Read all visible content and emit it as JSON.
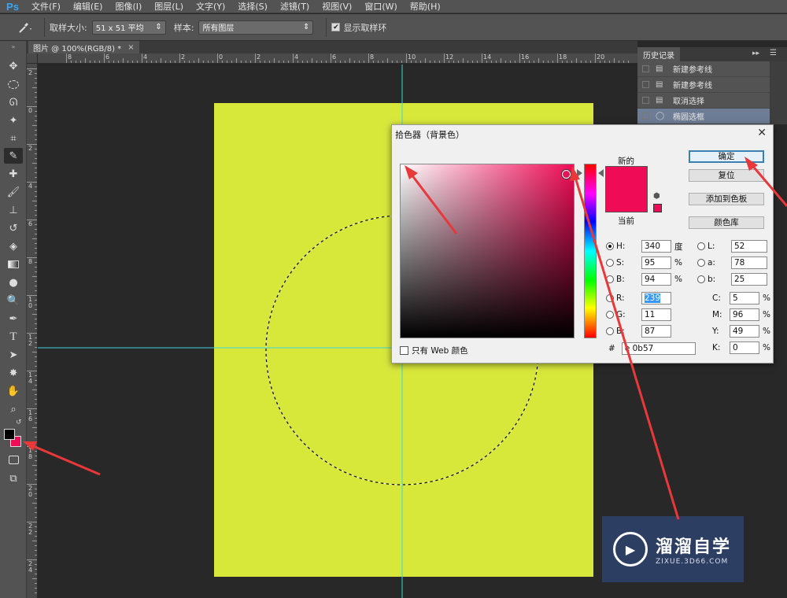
{
  "app": {
    "logo": "Ps"
  },
  "menu": [
    "文件(F)",
    "编辑(E)",
    "图像(I)",
    "图层(L)",
    "文字(Y)",
    "选择(S)",
    "滤镜(T)",
    "视图(V)",
    "窗口(W)",
    "帮助(H)"
  ],
  "options": {
    "sample_size_label": "取样大小:",
    "sample_size_value": "51 x 51 平均",
    "sample_label": "样本:",
    "sample_value": "所有图层",
    "show_ring_label": "显示取样环",
    "show_ring_checked": true
  },
  "document": {
    "tab_title": "图片 @ 100%(RGB/8) *",
    "tab_close": "×",
    "canvas_color": "#d8e83b"
  },
  "rulers": {
    "h_labels": [
      "8",
      "6",
      "4",
      "2",
      "0",
      "2",
      "4",
      "6",
      "8",
      "10",
      "12",
      "14",
      "16",
      "18",
      "20"
    ],
    "v_labels": [
      "2",
      "0",
      "2",
      "4",
      "6",
      "8",
      "1 0",
      "1 2",
      "1 4",
      "1 6",
      "1 8",
      "2 0",
      "2 2",
      "2 4"
    ]
  },
  "history": {
    "title": "历史记录",
    "items": [
      {
        "label": "新建参考线",
        "icon": "document-icon",
        "selected": false
      },
      {
        "label": "新建参考线",
        "icon": "document-icon",
        "selected": false
      },
      {
        "label": "取消选择",
        "icon": "document-icon",
        "selected": false
      },
      {
        "label": "椭圆选框",
        "icon": "ellipse-marquee-icon",
        "selected": true
      }
    ]
  },
  "picker": {
    "title": "拾色器（背景色）",
    "new_label": "新的",
    "current_label": "当前",
    "new_color": "#f00b57",
    "buttons": {
      "ok": "确定",
      "reset": "复位",
      "add_swatch": "添加到色板",
      "color_library": "颜色库"
    },
    "hsb": [
      {
        "label": "H:",
        "value": "340",
        "unit": "度",
        "selected": true
      },
      {
        "label": "S:",
        "value": "95",
        "unit": "%",
        "selected": false
      },
      {
        "label": "B:",
        "value": "94",
        "unit": "%",
        "selected": false
      }
    ],
    "rgb": [
      {
        "label": "R:",
        "value": "239",
        "selected": false,
        "highlight": true
      },
      {
        "label": "G:",
        "value": "11",
        "selected": false,
        "highlight": false
      },
      {
        "label": "B:",
        "value": "87",
        "selected": false,
        "highlight": false
      }
    ],
    "lab": [
      {
        "label": "L:",
        "value": "52"
      },
      {
        "label": "a:",
        "value": "78"
      },
      {
        "label": "b:",
        "value": "25"
      }
    ],
    "cmyk": [
      {
        "label": "C:",
        "value": "5",
        "unit": "%"
      },
      {
        "label": "M:",
        "value": "96",
        "unit": "%"
      },
      {
        "label": "Y:",
        "value": "49",
        "unit": "%"
      },
      {
        "label": "K:",
        "value": "0",
        "unit": "%"
      }
    ],
    "web_only_label": "只有 Web 颜色",
    "hex_label": "#",
    "hex_value": "e 0b57"
  },
  "watermark": {
    "title": "溜溜自学",
    "url": "ZIXUE.3D66.COM"
  },
  "colors": {
    "foreground": "#000000",
    "background": "#f00b57",
    "guide": "#3fd3dc",
    "annotation_arrow": "#e8383a"
  }
}
